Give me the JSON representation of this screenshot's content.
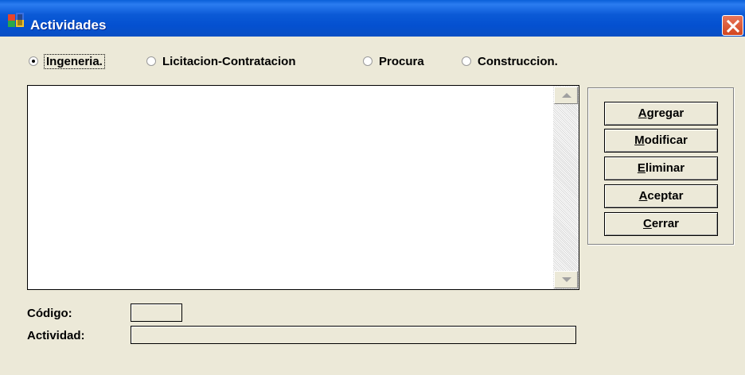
{
  "window": {
    "title": "Actividades",
    "accent": "#0a5fd8",
    "close_color": "#d2461f"
  },
  "radios": [
    {
      "label": "Ingeneria.",
      "checked": true
    },
    {
      "label": "Licitacion-Contratacion",
      "checked": false
    },
    {
      "label": "Procura",
      "checked": false
    },
    {
      "label": "Construccion.",
      "checked": false
    }
  ],
  "buttons": {
    "agregar": {
      "hot": "A",
      "rest": "gregar"
    },
    "modificar": {
      "hot": "M",
      "rest": "odificar"
    },
    "eliminar": {
      "hot": "E",
      "rest": "liminar"
    },
    "aceptar": {
      "hot": "A",
      "rest": "ceptar"
    },
    "cerrar": {
      "hot": "C",
      "rest": "errar"
    }
  },
  "fields": {
    "codigo": {
      "label": "Código:",
      "value": ""
    },
    "actividad": {
      "label": "Actividad:",
      "value": ""
    }
  }
}
